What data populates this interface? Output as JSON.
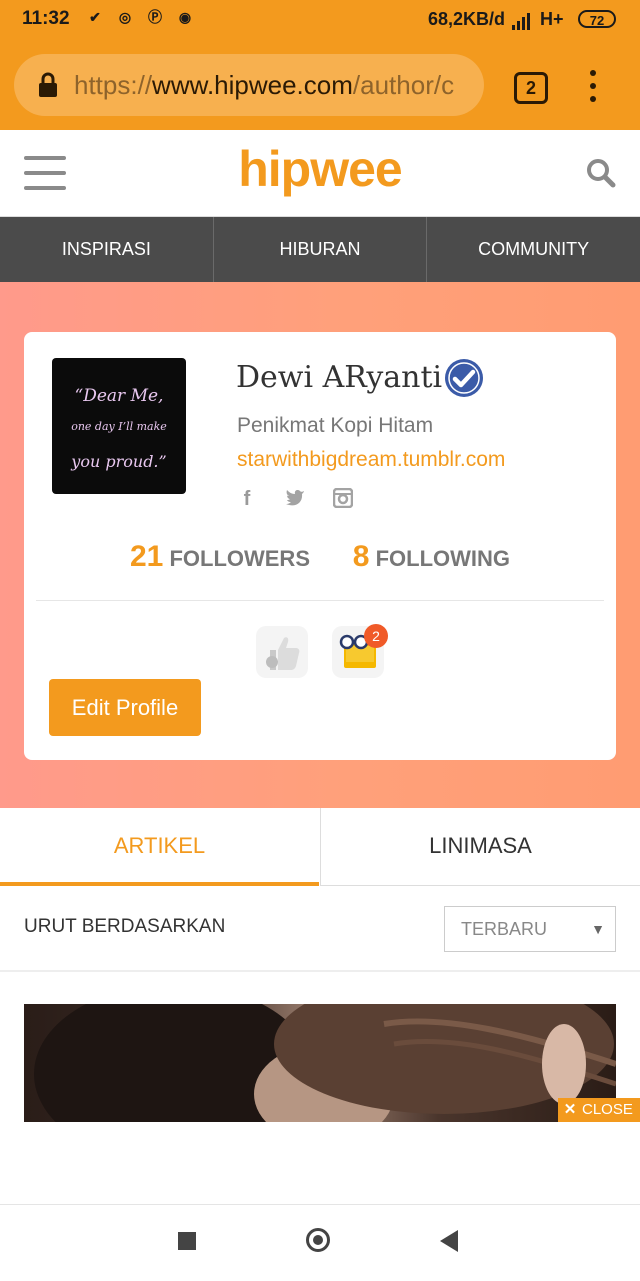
{
  "status_bar": {
    "time": "11:32",
    "notification_icons": [
      "check-download-icon",
      "whatsapp-icon",
      "pinterest-icon",
      "chrome-icon"
    ],
    "network_speed": "68,2KB/d",
    "network_type": "H+",
    "battery": "72"
  },
  "browser": {
    "url_prefix": "https://",
    "url_domain": "www.hipwee.com",
    "url_path": "/author/c",
    "tab_count": "2"
  },
  "site": {
    "logo": "hipwee",
    "brand_color": "#f39a1e"
  },
  "nav": {
    "items": [
      "INSPIRASI",
      "HIBURAN",
      "COMMUNITY"
    ]
  },
  "profile": {
    "avatar_lines": [
      "“Dear Me,",
      "one day I’ll make",
      "you proud.”"
    ],
    "name": "Dewi ARyanti",
    "tagline": "Penikmat Kopi Hitam",
    "website": "starwithbigdream.tumblr.com",
    "social_icons": [
      "facebook-icon",
      "twitter-icon",
      "instagram-icon"
    ],
    "followers_count": "21",
    "followers_label": "FOLLOWERS",
    "following_count": "8",
    "following_label": "FOLLOWING",
    "badge_count": "2",
    "edit_button": "Edit Profile"
  },
  "tabs": {
    "active": "ARTIKEL",
    "other": "LINIMASA"
  },
  "sort": {
    "label": "URUT BERDASARKAN",
    "selected": "TERBARU"
  },
  "ad": {
    "close_label": "CLOSE"
  }
}
